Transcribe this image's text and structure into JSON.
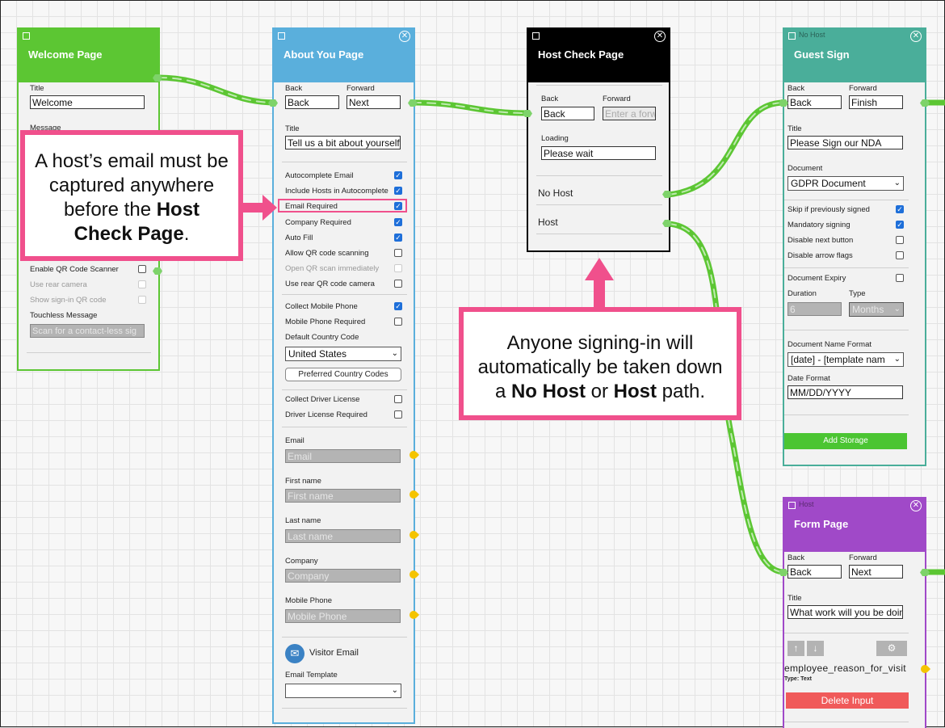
{
  "welcome": {
    "title": "Welcome Page",
    "title_label": "Title",
    "title_value": "Welcome",
    "message_label": "Message",
    "qr_scanner": "Enable QR Code Scanner",
    "rear_camera": "Use rear camera",
    "show_qr": "Show sign-in QR code",
    "touchless_label": "Touchless Message",
    "touchless_placeholder": "Scan for a contact-less sig"
  },
  "about": {
    "title": "About You Page",
    "back_label": "Back",
    "forward_label": "Forward",
    "back_value": "Back",
    "forward_value": "Next",
    "title_label": "Title",
    "title_value": "Tell us a bit about yourself",
    "checks": [
      {
        "label": "Autocomplete Email",
        "checked": true
      },
      {
        "label": "Include Hosts in Autocomplete",
        "checked": true
      },
      {
        "label": "Email Required",
        "checked": true
      },
      {
        "label": "Company Required",
        "checked": true
      },
      {
        "label": "Auto Fill",
        "checked": true
      },
      {
        "label": "Allow QR code scanning",
        "checked": false
      },
      {
        "label": "Open QR scan immediately",
        "checked": false
      },
      {
        "label": "Use rear QR code camera",
        "checked": false
      }
    ],
    "collect_mobile": "Collect Mobile Phone",
    "mobile_required": "Mobile Phone Required",
    "country_label": "Default Country Code",
    "country_value": "United States",
    "preferred_btn": "Preferred Country Codes",
    "collect_license": "Collect Driver License",
    "license_required": "Driver License Required",
    "fields": [
      {
        "label": "Email",
        "placeholder": "Email"
      },
      {
        "label": "First name",
        "placeholder": "First name"
      },
      {
        "label": "Last name",
        "placeholder": "Last name"
      },
      {
        "label": "Company",
        "placeholder": "Company"
      },
      {
        "label": "Mobile Phone",
        "placeholder": "Mobile Phone"
      }
    ],
    "visitor_email": "Visitor Email",
    "template_label": "Email Template",
    "template_value": ""
  },
  "host_check": {
    "title": "Host Check Page",
    "back_label": "Back",
    "forward_label": "Forward",
    "back_value": "Back",
    "forward_placeholder": "Enter a forw",
    "loading_label": "Loading",
    "loading_value": "Please wait",
    "no_host": "No Host",
    "host": "Host"
  },
  "guest_sign": {
    "tag": "No Host",
    "title": "Guest Sign",
    "back_label": "Back",
    "forward_label": "Forward",
    "back_value": "Back",
    "forward_value": "Finish",
    "title_label": "Title",
    "title_value": "Please Sign our NDA",
    "document_label": "Document",
    "document_value": "GDPR Document",
    "skip": "Skip if previously signed",
    "mandatory": "Mandatory signing",
    "disable_next": "Disable next button",
    "disable_arrow": "Disable arrow flags",
    "expiry": "Document Expiry",
    "duration_label": "Duration",
    "type_label": "Type",
    "duration_value": "6",
    "type_value": "Months",
    "name_format_label": "Document Name Format",
    "name_format_value": "[date] - [template nam",
    "date_format_label": "Date Format",
    "date_format_value": "MM/DD/YYYY",
    "add_storage": "Add Storage"
  },
  "form_page": {
    "tag": "Host",
    "title": "Form Page",
    "back_label": "Back",
    "forward_label": "Forward",
    "back_value": "Back",
    "forward_value": "Next",
    "title_label": "Title",
    "title_value": "What work will you be doin",
    "input_name": "employee_reason_for_visit",
    "input_type": "Type: Text",
    "delete_btn": "Delete Input"
  },
  "callout_left": {
    "line1": "A host’s email must be",
    "line2": "captured anywhere",
    "line3a": "before the ",
    "line3b": "Host",
    "line4a": "Check Page",
    "line4b": "."
  },
  "callout_right": {
    "line1": "Anyone signing-in will",
    "line2": "automatically be taken down",
    "line3a": "a ",
    "line3b": "No Host",
    "line3c": " or ",
    "line3d": "Host",
    "line3e": " path."
  },
  "colors": {
    "welcome": "#5cc633",
    "about": "#5aafdc",
    "host_check": "#000000",
    "guest_sign": "#4aae9a",
    "form_page": "#a049c8",
    "callout_border": "#f0508c",
    "connector": "#5cc633"
  }
}
